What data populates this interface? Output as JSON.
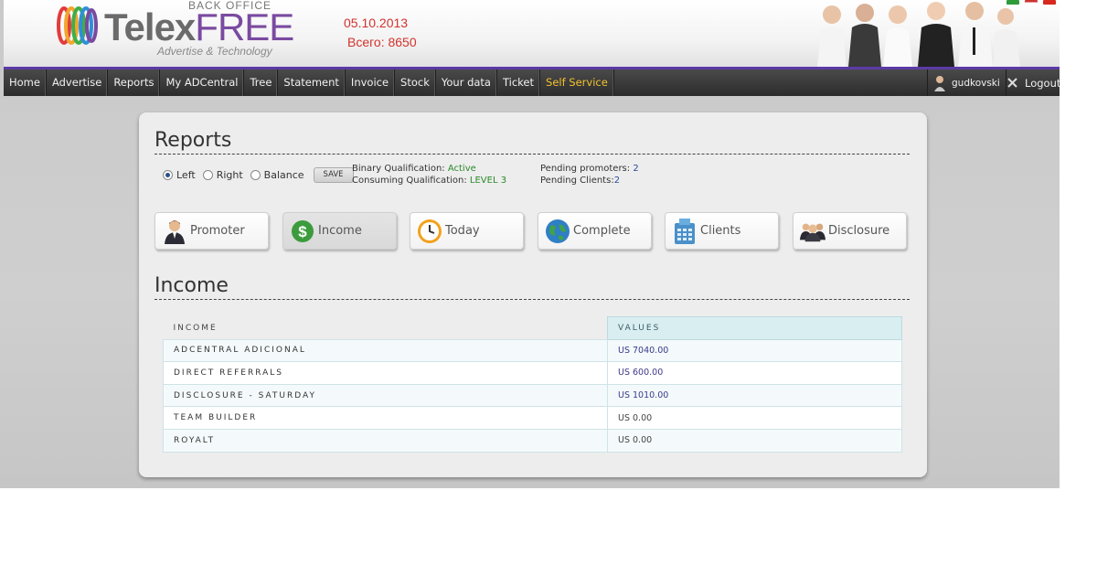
{
  "header": {
    "back_office": "BACK OFFICE",
    "brand_main": "Telex",
    "brand_accent": "FREE",
    "tagline": "Advertise & Technology",
    "date": "05.10.2013",
    "total": "Всего: 8650"
  },
  "nav": {
    "items": [
      "Home",
      "Advertise",
      "Reports",
      "My ADCentral",
      "Tree",
      "Statement",
      "Invoice",
      "Stock",
      "Your data",
      "Ticket",
      "Self Service"
    ],
    "user": "gudkovski",
    "logout": "Logout"
  },
  "reports": {
    "title": "Reports",
    "options": {
      "left": "Left",
      "right": "Right",
      "balance": "Balance",
      "selected": "Left",
      "save": "SAVE"
    },
    "binary_label": "Binary Qualification:",
    "binary_value": "Active",
    "consuming_label": "Consuming Qualification:",
    "consuming_value": "LEVEL 3",
    "pending_promoters_label": "Pending promoters:",
    "pending_promoters_value": "2",
    "pending_clients_label": "Pending Clients:",
    "pending_clients_value": "2",
    "tiles": [
      {
        "label": "Promoter",
        "icon": "promoter-icon"
      },
      {
        "label": "Income",
        "icon": "dollar-icon"
      },
      {
        "label": "Today",
        "icon": "clock-icon"
      },
      {
        "label": "Complete",
        "icon": "globe-icon"
      },
      {
        "label": "Clients",
        "icon": "calculator-icon"
      },
      {
        "label": "Disclosure",
        "icon": "group-icon"
      }
    ],
    "active_tile": "Income"
  },
  "income": {
    "title": "Income",
    "headers": {
      "income": "INCOME",
      "values": "VALUES"
    },
    "rows": [
      {
        "label": "ADCENTRAL ADICIONAL",
        "value": "US 7040.00"
      },
      {
        "label": "DIRECT REFERRALS",
        "value": "US 600.00"
      },
      {
        "label": "DISCLOSURE - SATURDAY",
        "value": "US 1010.00"
      },
      {
        "label": "TEAM BUILDER",
        "value": "US 0.00"
      },
      {
        "label": "ROYALT",
        "value": "US 0.00"
      }
    ]
  },
  "colors": {
    "nav_accent": "#5b3aa6",
    "self_service": "#f2c22e",
    "date_red": "#d2322d",
    "status_green": "#2a8a2a"
  }
}
